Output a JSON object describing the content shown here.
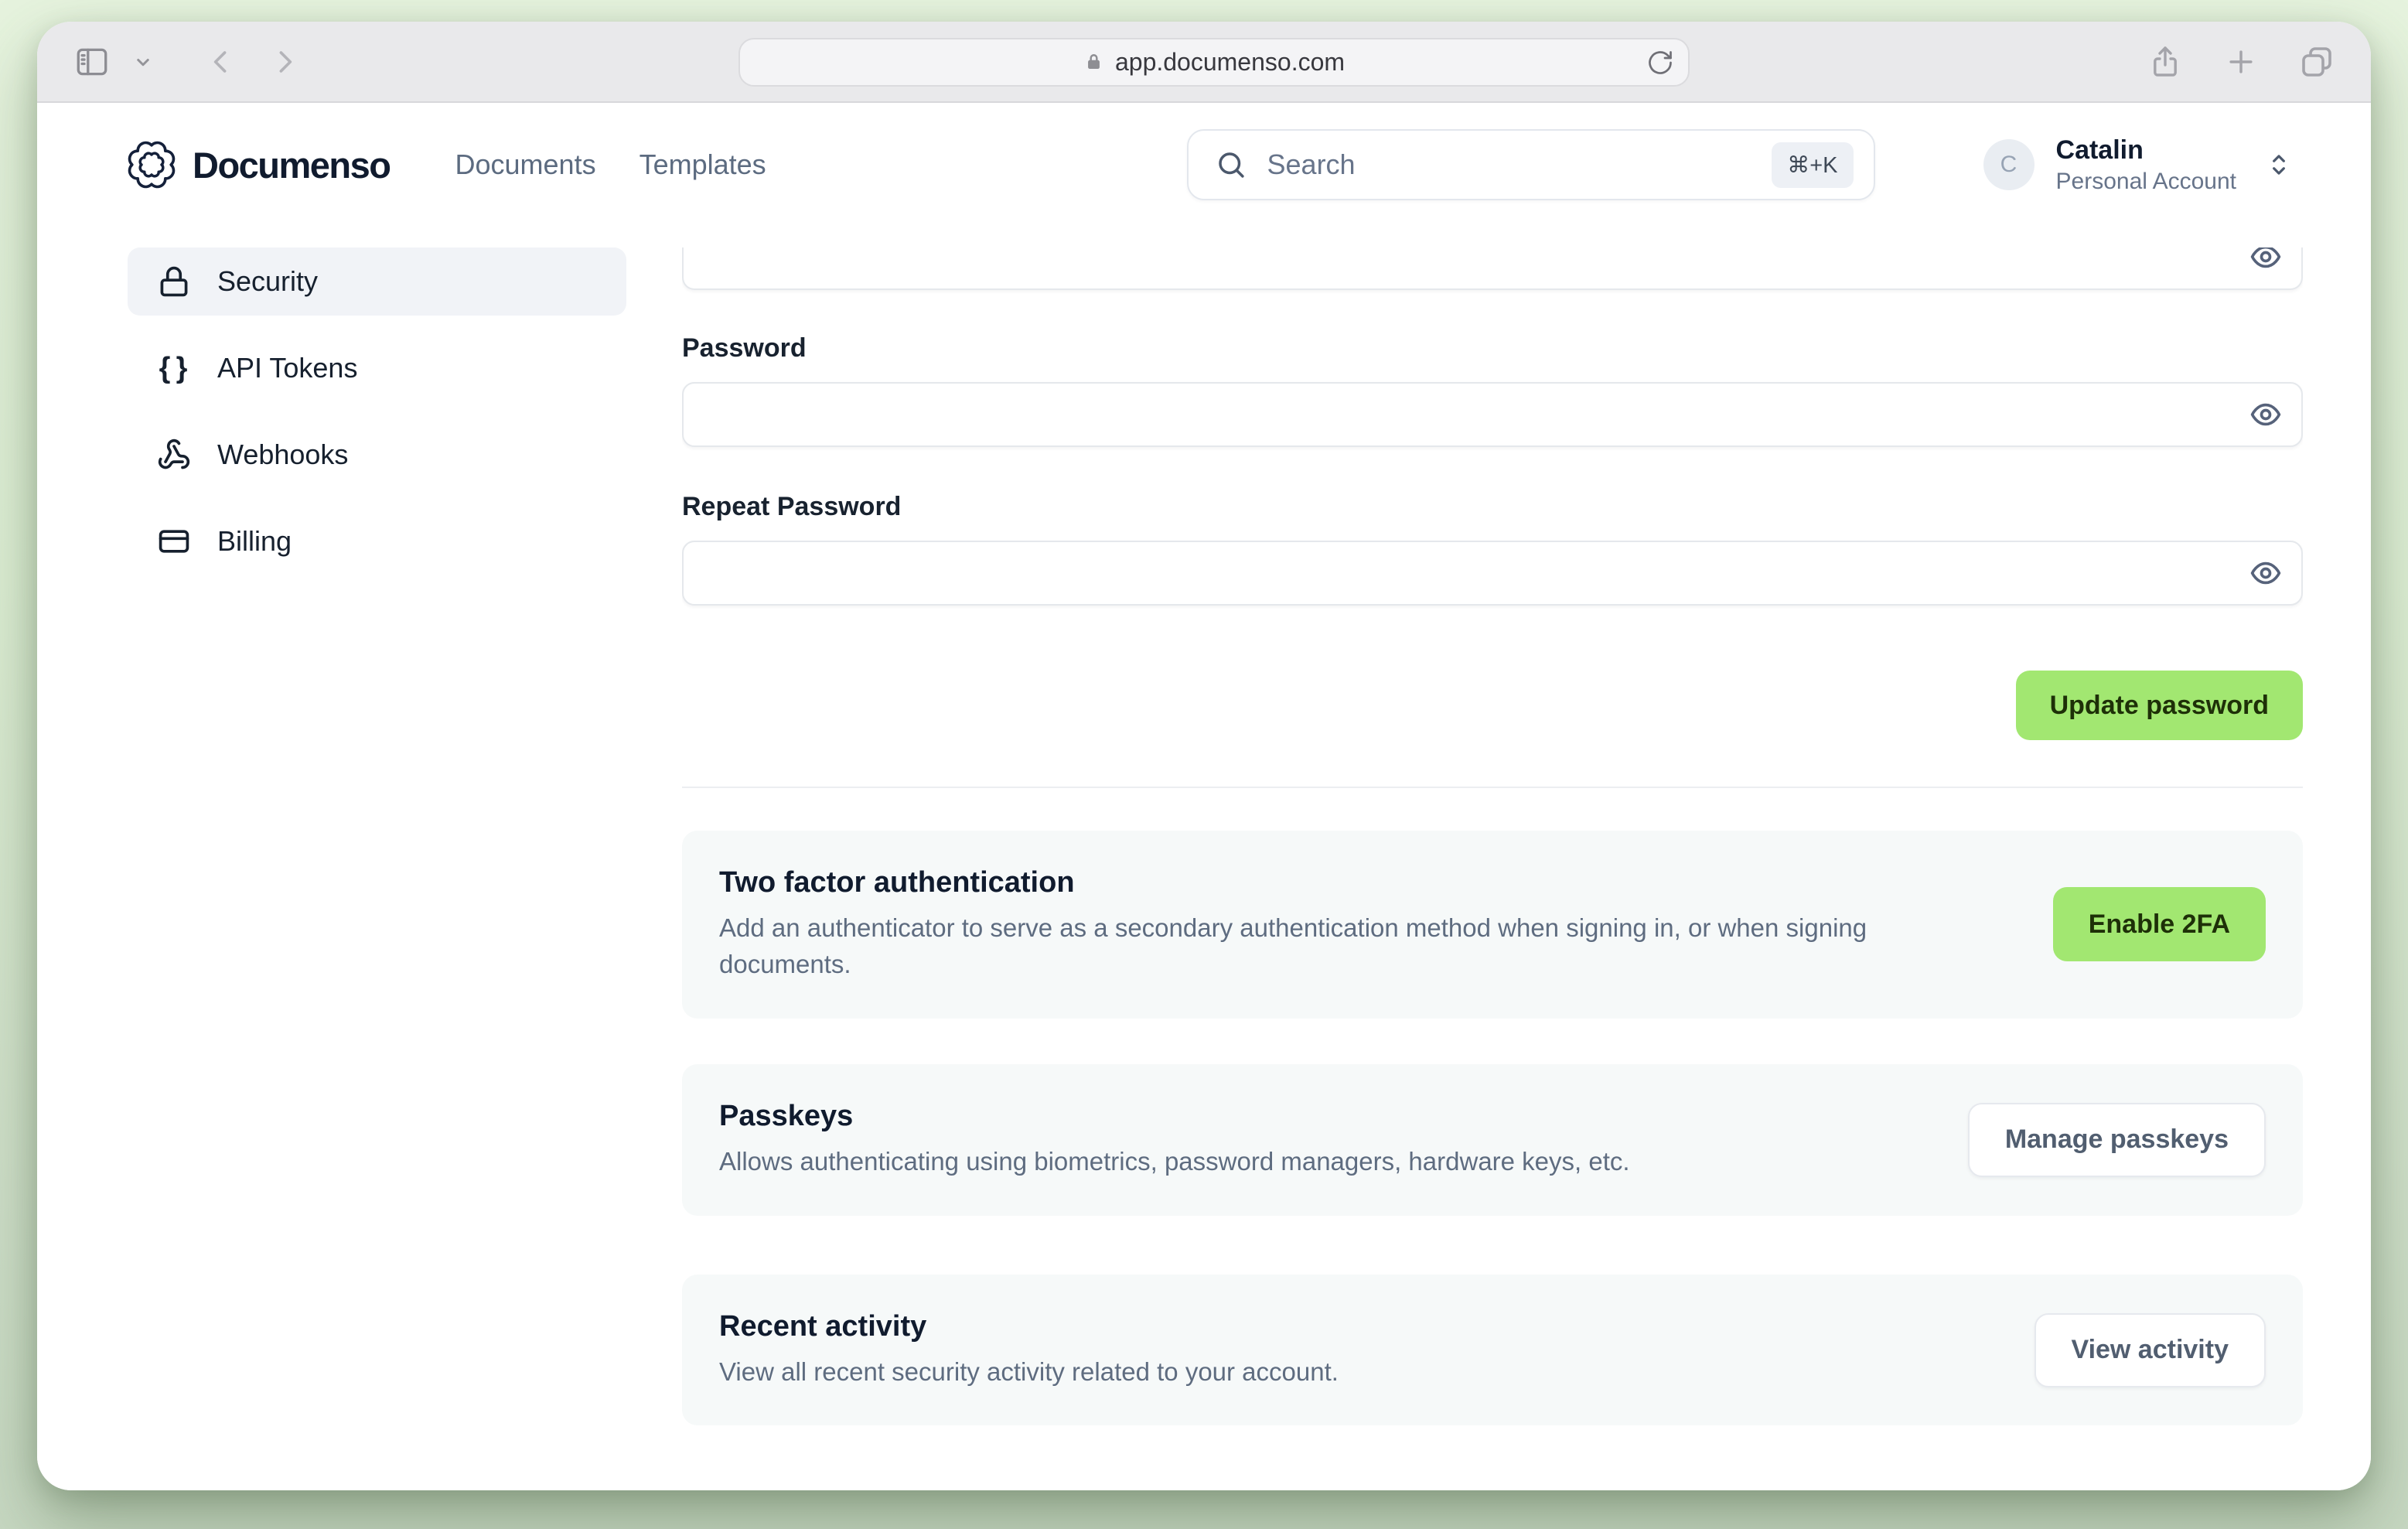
{
  "browser": {
    "url": "app.documenso.com"
  },
  "header": {
    "brand": "Documenso",
    "nav": [
      {
        "label": "Documents"
      },
      {
        "label": "Templates"
      }
    ],
    "search": {
      "placeholder": "Search",
      "shortcut": "⌘+K"
    },
    "account": {
      "initial": "C",
      "name": "Catalin",
      "type": "Personal Account"
    }
  },
  "sidebar": {
    "items": [
      {
        "label": "Security",
        "icon": "lock-icon",
        "active": true
      },
      {
        "label": "API Tokens",
        "icon": "braces-icon",
        "active": false
      },
      {
        "label": "Webhooks",
        "icon": "webhook-icon",
        "active": false
      },
      {
        "label": "Billing",
        "icon": "credit-card-icon",
        "active": false
      }
    ]
  },
  "main": {
    "form": {
      "password_label": "Password",
      "repeat_password_label": "Repeat Password",
      "submit_label": "Update password"
    },
    "cards": [
      {
        "title": "Two factor authentication",
        "description": "Add an authenticator to serve as a secondary authentication method when signing in, or when signing documents.",
        "button": "Enable 2FA",
        "button_style": "primary"
      },
      {
        "title": "Passkeys",
        "description": "Allows authenticating using biometrics, password managers, hardware keys, etc.",
        "button": "Manage passkeys",
        "button_style": "secondary"
      },
      {
        "title": "Recent activity",
        "description": "View all recent security activity related to your account.",
        "button": "View activity",
        "button_style": "secondary"
      }
    ]
  },
  "colors": {
    "accent_green": "#a2e771",
    "accent_green_text": "#1e3008",
    "sidebar_active_bg": "#f1f3f7",
    "card_bg": "#f6f9f9",
    "desktop_green": "#ddeed4",
    "chrome_gray": "#e9e9eb"
  }
}
